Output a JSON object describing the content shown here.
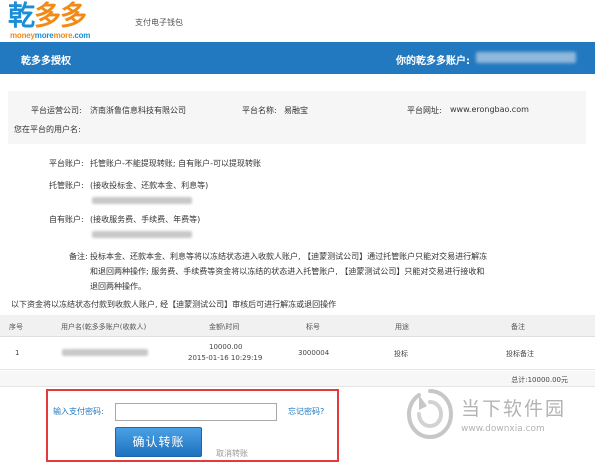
{
  "header": {
    "logo_chars": [
      "乾",
      "多",
      "多"
    ],
    "logo_tag_money": "money",
    "logo_tag_more1": "more",
    "logo_tag_more2": "more",
    "logo_tag_com": ".com",
    "subtitle": "支付电子钱包"
  },
  "bar": {
    "title": "乾多多授权",
    "account_label": "你的乾多多账户:"
  },
  "platform": {
    "company_label": "平台运营公司:",
    "company_value": "济南浙鲁信息科技有限公司",
    "name_label": "平台名称:",
    "name_value": "易融宝",
    "site_label": "平台网址:",
    "site_value": "www.erongbao.com",
    "username_label": "您在平台的用户名:"
  },
  "accounts": {
    "platform_accounts_label": "平台账户:",
    "platform_accounts_value": "托管账户-不能提现转账; 自有账户-可以提现转账",
    "escrow_label": "托管账户:",
    "escrow_value": "(接收投标金、还款本金、利息等)",
    "own_label": "自有账户:",
    "own_value": "(接收服务费、手续费、年费等)",
    "remark_label": "备注:",
    "remark_line1": "投标本金、还款本金、利息等将以冻结状态进入收款人账户, 【迪蒙测试公司】通过托管账户只能对交易进行解冻",
    "remark_line2": "和退回两种操作; 服务费、手续费等资金将以冻结的状态进入托管账户, 【迪蒙测试公司】只能对交易进行接收和",
    "remark_line3": "退回两种操作。"
  },
  "note": "以下资金将以冻结状态付款到收款人账户, 经【迪蒙测试公司】审核后可进行解冻或退回操作",
  "table": {
    "headers": [
      "序号",
      "用户名(乾多多账户(收款人)",
      "金额\\时间",
      "标号",
      "用途",
      "备注"
    ],
    "rows": [
      {
        "index": "1",
        "amount": "10000.00",
        "time": "2015-01-16 10:29:19",
        "number": "3000004",
        "purpose": "投标",
        "remark": "投标备注"
      }
    ],
    "total": "总计:10000.00元"
  },
  "payment": {
    "password_label": "输入支付密码:",
    "password_placeholder": "",
    "forgot_label": "忘记密码?",
    "confirm_label": "确认转账",
    "cancel_label": "取消转账"
  },
  "watermark": {
    "title": "当下软件园",
    "url": "www.downxia.com"
  },
  "colors": {
    "brand_blue": "#2279bf",
    "brand_orange": "#f28a16",
    "highlight_red": "#e33b3b"
  }
}
